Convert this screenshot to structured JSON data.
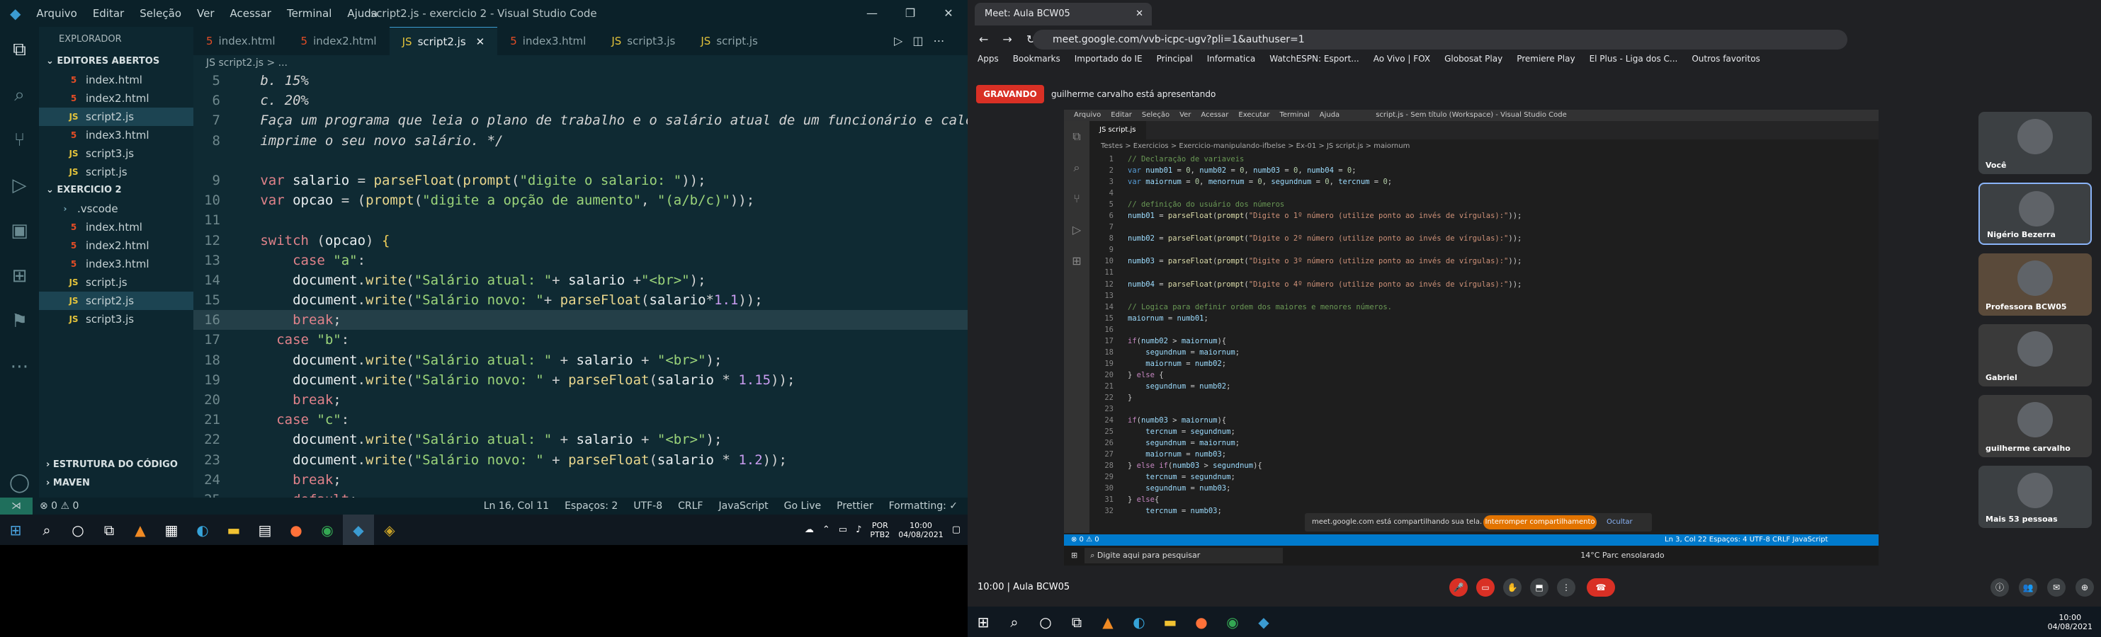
{
  "left": {
    "menu": [
      "Arquivo",
      "Editar",
      "Seleção",
      "Ver",
      "Acessar",
      "Terminal",
      "Ajuda"
    ],
    "window_title": "script2.js - exercicio 2 - Visual Studio Code",
    "explorer_title": "EXPLORADOR",
    "open_editors": "EDITORES ABERTOS",
    "open_files": [
      {
        "n": "index.html",
        "t": "h"
      },
      {
        "n": "index2.html",
        "t": "h"
      },
      {
        "n": "script2.js",
        "t": "j"
      },
      {
        "n": "index3.html",
        "t": "h"
      },
      {
        "n": "script3.js",
        "t": "j"
      },
      {
        "n": "script.js",
        "t": "j"
      }
    ],
    "folder": "EXERCICIO 2",
    "folder_files": [
      {
        "n": ".vscode",
        "t": "f"
      },
      {
        "n": "index.html",
        "t": "h"
      },
      {
        "n": "index2.html",
        "t": "h"
      },
      {
        "n": "index3.html",
        "t": "h"
      },
      {
        "n": "script.js",
        "t": "j"
      },
      {
        "n": "script2.js",
        "t": "j"
      },
      {
        "n": "script3.js",
        "t": "j"
      }
    ],
    "outline": "ESTRUTURA DO CÓDIGO",
    "maven": "MAVEN",
    "tabs": [
      {
        "n": "index.html",
        "t": "h"
      },
      {
        "n": "index2.html",
        "t": "h"
      },
      {
        "n": "script2.js",
        "t": "j"
      },
      {
        "n": "index3.html",
        "t": "h"
      },
      {
        "n": "script3.js",
        "t": "j"
      },
      {
        "n": "script.js",
        "t": "j"
      }
    ],
    "breadcrumb": "JS script2.js > ...",
    "status_left": "⊗ 0 ⚠ 0",
    "status_right": [
      "Ln 16, Col 11",
      "Espaços: 2",
      "UTF-8",
      "CRLF",
      "JavaScript",
      "Go Live",
      "Prettier",
      "Formatting: ✓"
    ],
    "clock_time": "10:00",
    "clock_date": "04/08/2021",
    "lang": "POR",
    "lang2": "PTB2"
  },
  "right": {
    "tab_title": "Meet: Aula BCW05",
    "url": "meet.google.com/vvb-icpc-ugv?pli=1&authuser=1",
    "bookmarks": [
      "Apps",
      "Bookmarks",
      "Importado do IE",
      "Principal",
      "Informatica",
      "WatchESPN: Esport...",
      "Ao Vivo | FOX",
      "Globosat Play",
      "Premiere Play",
      "El Plus - Liga dos C...",
      "Outros favoritos"
    ],
    "recording": "GRAVANDO",
    "presenting": "guilherme carvalho está apresentando",
    "nested_title": "script.js - Sem título (Workspace) - Visual Studio Code",
    "nested_menu": [
      "Arquivo",
      "Editar",
      "Seleção",
      "Ver",
      "Acessar",
      "Executar",
      "Terminal",
      "Ajuda"
    ],
    "nested_tab": "JS script.js",
    "nested_bc": "Testes > Exercicios > Exercicio-manipulando-ifbelse > Ex-01 > JS script.js > maiornum",
    "nested_status": "⊗ 0 ⚠ 0",
    "nested_status_right": "Ln 3, Col 22   Espaços: 4   UTF-8   CRLF   JavaScript",
    "share_msg": "meet.google.com está compartilhando sua tela.",
    "share_btn": "Interromper compartilhamento",
    "share_hide": "Ocultar",
    "search_ph": "Digite aqui para pesquisar",
    "weather": "14°C  Parc ensolarado",
    "participants": [
      "Você",
      "Nigério Bezerra",
      "Professora BCW05",
      "Gabriel",
      "guilherme carvalho",
      "Mais 53 pessoas"
    ],
    "meet_time": "10:00 | Aula BCW05",
    "clock_time": "10:00",
    "clock_date": "04/08/2021"
  }
}
